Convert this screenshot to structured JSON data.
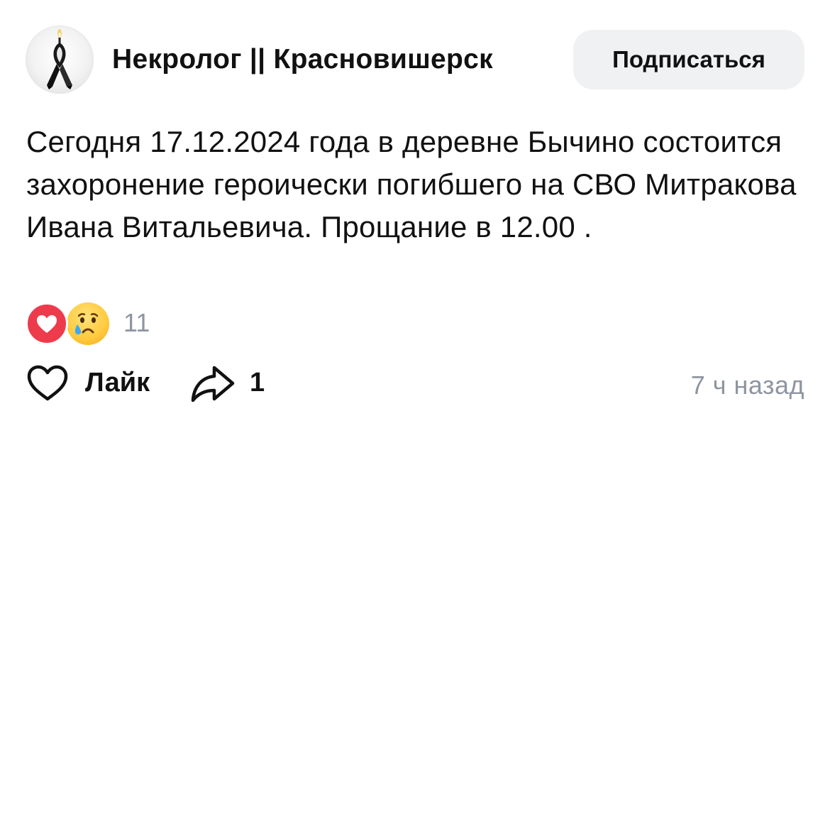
{
  "header": {
    "avatar_icon": "black-mourning-ribbon-candle-icon",
    "channel_name": "Некролог || Красновишерск",
    "subscribe_label": "Подписаться"
  },
  "post": {
    "text": "Сегодня 17.12.2024 года в деревне Бычино состоится захоронение героически погибшего на СВО Митракова Ивана Витальевича. Прощание в 12.00 ."
  },
  "reactions": {
    "items": [
      {
        "icon": "heart-icon",
        "color": "#ee3b4b"
      },
      {
        "icon": "crying-face-icon",
        "color": "#ffc93c"
      }
    ],
    "count": "11"
  },
  "actions": {
    "like_icon": "heart-outline-icon",
    "like_label": "Лайк",
    "share_icon": "share-arrow-icon",
    "share_count": "1",
    "timestamp": "7 ч назад"
  },
  "colors": {
    "muted_text": "#8e95a1",
    "button_bg": "#f0f1f3",
    "heart_red": "#ee3b4b"
  }
}
